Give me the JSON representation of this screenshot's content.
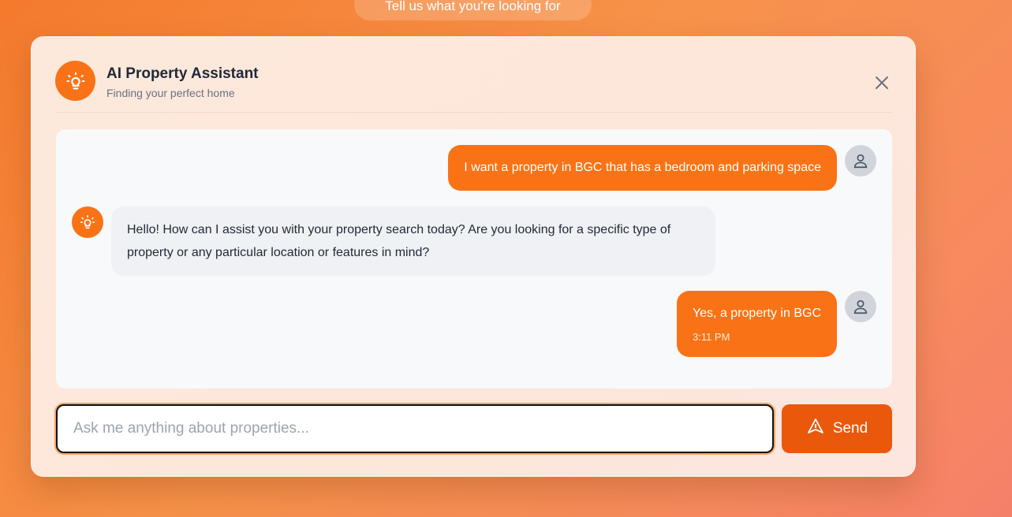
{
  "top_pill": {
    "label": "Tell us what you're looking for"
  },
  "header": {
    "title": "AI Property Assistant",
    "subtitle": "Finding your perfect home"
  },
  "messages": [
    {
      "role": "user",
      "text": "I want a property in BGC that has a bedroom and parking space"
    },
    {
      "role": "assistant",
      "text": "Hello! How can I assist you with your property search today? Are you looking for a specific type of property or any particular location or features in mind?"
    },
    {
      "role": "user",
      "text": "Yes, a property in BGC",
      "time": "3:11 PM"
    }
  ],
  "composer": {
    "placeholder": "Ask me anything about properties...",
    "value": "",
    "send_label": "Send"
  },
  "colors": {
    "accent": "#f97316",
    "send": "#ea580c",
    "user_avatar": "#d1d5db"
  },
  "icons": {
    "logo": "lightbulb-icon",
    "close": "close-icon",
    "user_avatar": "user-icon",
    "send": "send-icon"
  }
}
